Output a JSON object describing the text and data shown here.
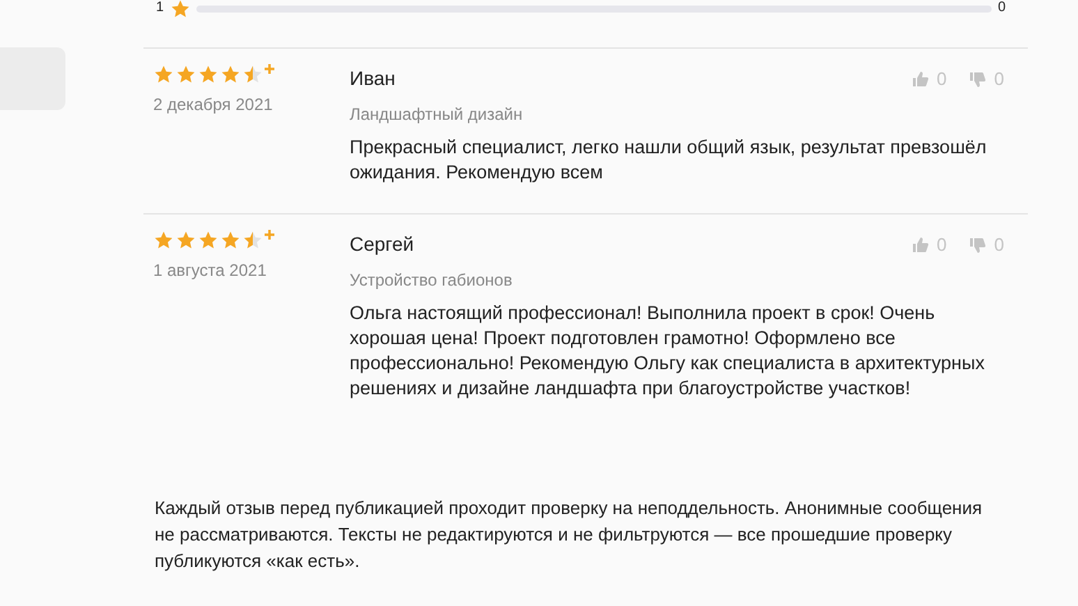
{
  "rating_bar": {
    "label": "1",
    "count": "0",
    "level": 0
  },
  "reviews": [
    {
      "stars": 4.5,
      "date": "2 декабря 2021",
      "author": "Иван",
      "service": "Ландшафтный дизайн",
      "text": "Прекрасный специалист, легко нашли общий язык, результат превзошёл ожидания. Рекомендую всем",
      "likes": "0",
      "dislikes": "0"
    },
    {
      "stars": 4.5,
      "date": "1 августа 2021",
      "author": "Сергей",
      "service": "Устройство габионов",
      "text": "Ольга настоящий профессионал! Выполнила проект в срок! Очень хорошая цена! Проект подготовлен грамотно! Оформлено все профессионально! Рекомендую Ольгу как специалиста в архитектурных решениях и дизайне ландшафта при благоустройстве участков!",
      "likes": "0",
      "dislikes": "0"
    }
  ],
  "disclaimer": "Каждый отзыв перед публикацией проходит проверку на неподдельность. Анонимные сообщения не рассматриваются. Тексты не редактируются и не фильтруются — все прошедшие проверку публикуются «как есть»."
}
